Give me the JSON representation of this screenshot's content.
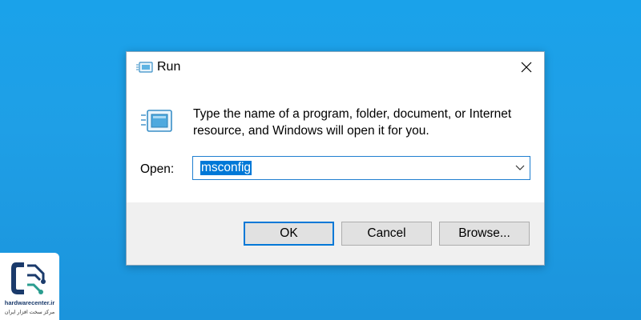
{
  "dialog": {
    "title": "Run",
    "description": "Type the name of a program, folder, document, or Internet resource, and Windows will open it for you.",
    "open_label": "Open:",
    "open_value": "msconfig",
    "buttons": {
      "ok": "OK",
      "cancel": "Cancel",
      "browse": "Browse..."
    },
    "icons": {
      "title": "run-icon",
      "main": "run-icon",
      "close": "close-icon",
      "dropdown": "chevron-down-icon"
    }
  },
  "watermark": {
    "site": "hardwarecenter.ir",
    "tagline": "مرکز سخت افزار ایران",
    "logo": "phone-plug-logo"
  },
  "colors": {
    "desktop": "#1aa2ea",
    "selection": "#0078d7",
    "footer": "#f0f0f0"
  }
}
